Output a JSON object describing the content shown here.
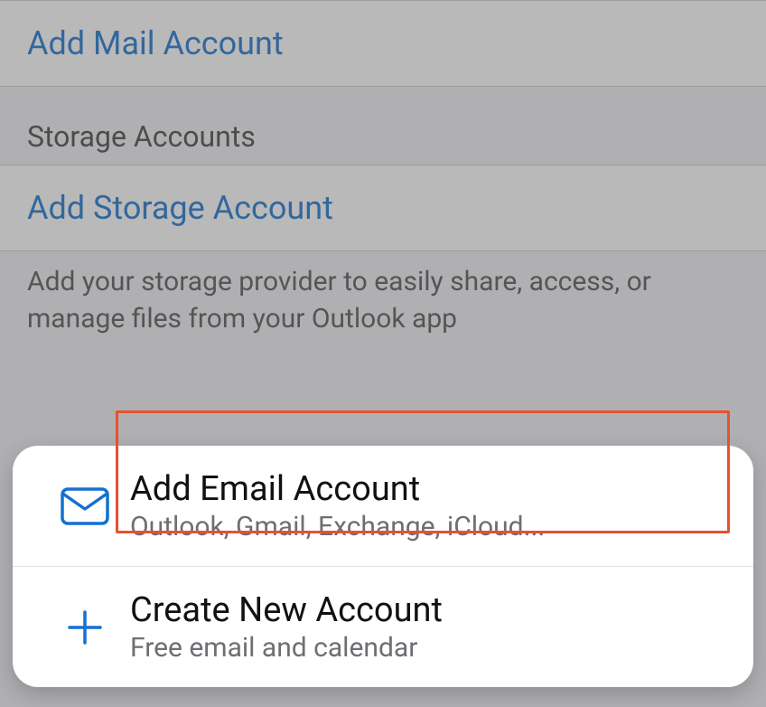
{
  "colors": {
    "link": "#0b6bcb",
    "highlight": "#e8512f",
    "icon": "#1570d1"
  },
  "background": {
    "add_mail_label": "Add Mail Account",
    "storage_header": "Storage Accounts",
    "add_storage_label": "Add Storage Account",
    "storage_footer": "Add your storage provider to easily share, access, or manage files from your Outlook app"
  },
  "sheet": {
    "add_email": {
      "title": "Add Email Account",
      "subtitle": "Outlook, Gmail, Exchange, iCloud..."
    },
    "create_new": {
      "title": "Create New Account",
      "subtitle": "Free email and calendar"
    }
  }
}
